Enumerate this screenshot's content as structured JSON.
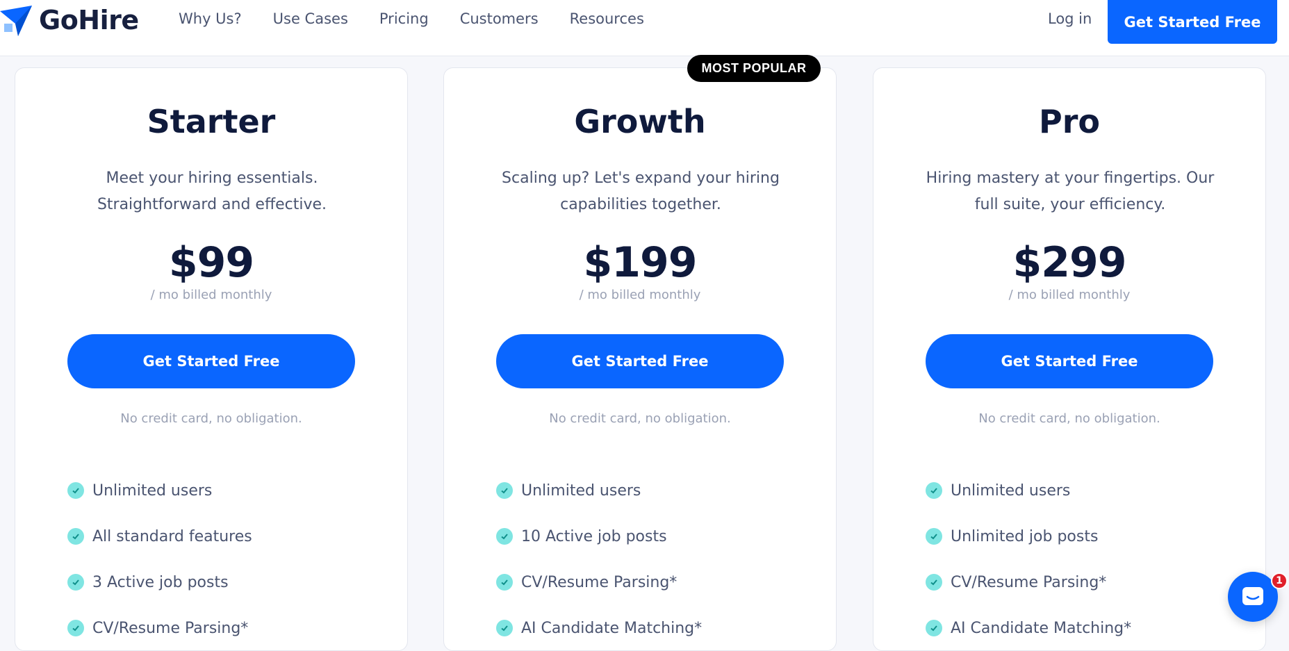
{
  "brand": {
    "name": "GoHire",
    "color": "#0a66ff"
  },
  "nav": {
    "items": [
      "Why Us?",
      "Use Cases",
      "Pricing",
      "Customers",
      "Resources"
    ],
    "login": "Log in",
    "cta": "Get Started Free"
  },
  "badge": "MOST POPULAR",
  "plans": [
    {
      "name": "Starter",
      "description": "Meet your hiring essentials. Straightforward and effective.",
      "price": "$99",
      "billing": "/ mo billed monthly",
      "cta": "Get Started Free",
      "note": "No credit card, no obligation.",
      "features": [
        "Unlimited users",
        "All standard features",
        "3 Active job posts",
        "CV/Resume Parsing*"
      ]
    },
    {
      "name": "Growth",
      "description": "Scaling up? Let's expand your hiring capabilities together.",
      "price": "$199",
      "billing": "/ mo billed monthly",
      "cta": "Get Started Free",
      "note": "No credit card, no obligation.",
      "features": [
        "Unlimited users",
        "10 Active job posts",
        "CV/Resume Parsing*",
        "AI Candidate Matching*"
      ]
    },
    {
      "name": "Pro",
      "description": "Hiring mastery at your fingertips. Our full suite, your efficiency.",
      "price": "$299",
      "billing": "/ mo billed monthly",
      "cta": "Get Started Free",
      "note": "No credit card, no obligation.",
      "features": [
        "Unlimited users",
        "Unlimited job posts",
        "CV/Resume Parsing*",
        "AI Candidate Matching*"
      ]
    }
  ],
  "chat": {
    "icon": "chat-icon",
    "unread": "1"
  }
}
